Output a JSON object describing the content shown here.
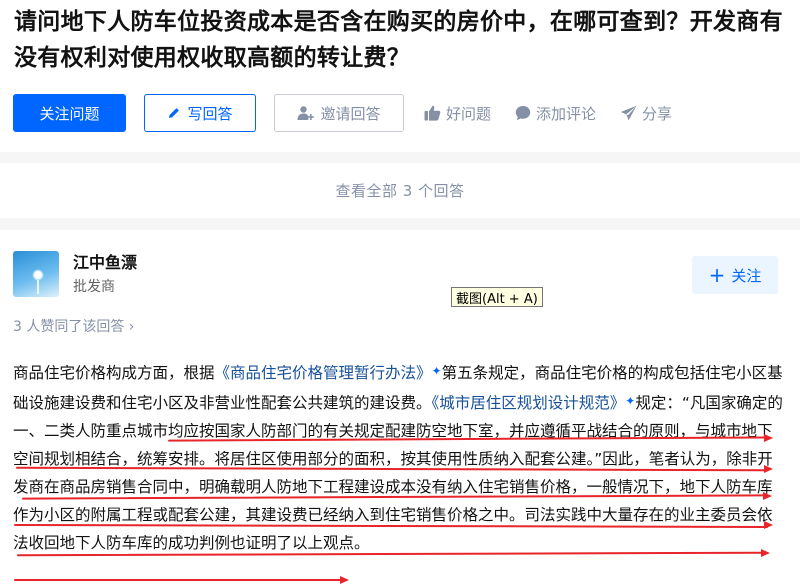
{
  "question": {
    "title": "请问地下人防车位投资成本是否含在购买的房价中，在哪可查到？开发商有没有权利对使用权收取高额的转让费？",
    "actions": {
      "follow": "关注问题",
      "write_answer": "写回答",
      "invite": "邀请回答",
      "good_question": "好问题",
      "add_comment": "添加评论",
      "share": "分享"
    }
  },
  "answers_link": "查看全部 3 个回答",
  "answer": {
    "author_name": "江中鱼漂",
    "author_bio": "批发商",
    "follow_label": "关注",
    "votes_text": "3 人赞同了该回答 ›",
    "content": {
      "p1": "商品住宅价格构成方面，根据",
      "link1": "《商品住宅价格管理暂行办法》",
      "p2": "第五条规定，商品住宅价格的构成包括住宅小区基础设施建设费和住宅小区及非营业性配套公共建筑的建设费。",
      "link2": "《城市居住区规划设计规范》",
      "p3": "规定：“凡国家确定的一、二类人防重点城市均应按国家人防部门的有关规定配建防空地下室，并应遵循平战结合的原则，与城市地下空间规划相结合，统筹安排。将居住区使用部分的面积，按其使用性质纳入配套公建。”因此，笔者认为，除非开发商在商品房销售合同中，明确载明人防地下工程建设成本没有纳入住宅销售价格，一般情况下，地下人防车库作为小区的附属工程或配套公建，其建设费已经纳入到住宅销售价格之中。司法实践中大量存在的业主委员会依法收回地下人防车库的成功判例也证明了以上观点。"
    }
  },
  "tooltip": "截图(Alt + A)",
  "colors": {
    "primary": "#0066ff",
    "link": "#175199",
    "muted": "#8590a6",
    "annotation": "#e8252a"
  }
}
